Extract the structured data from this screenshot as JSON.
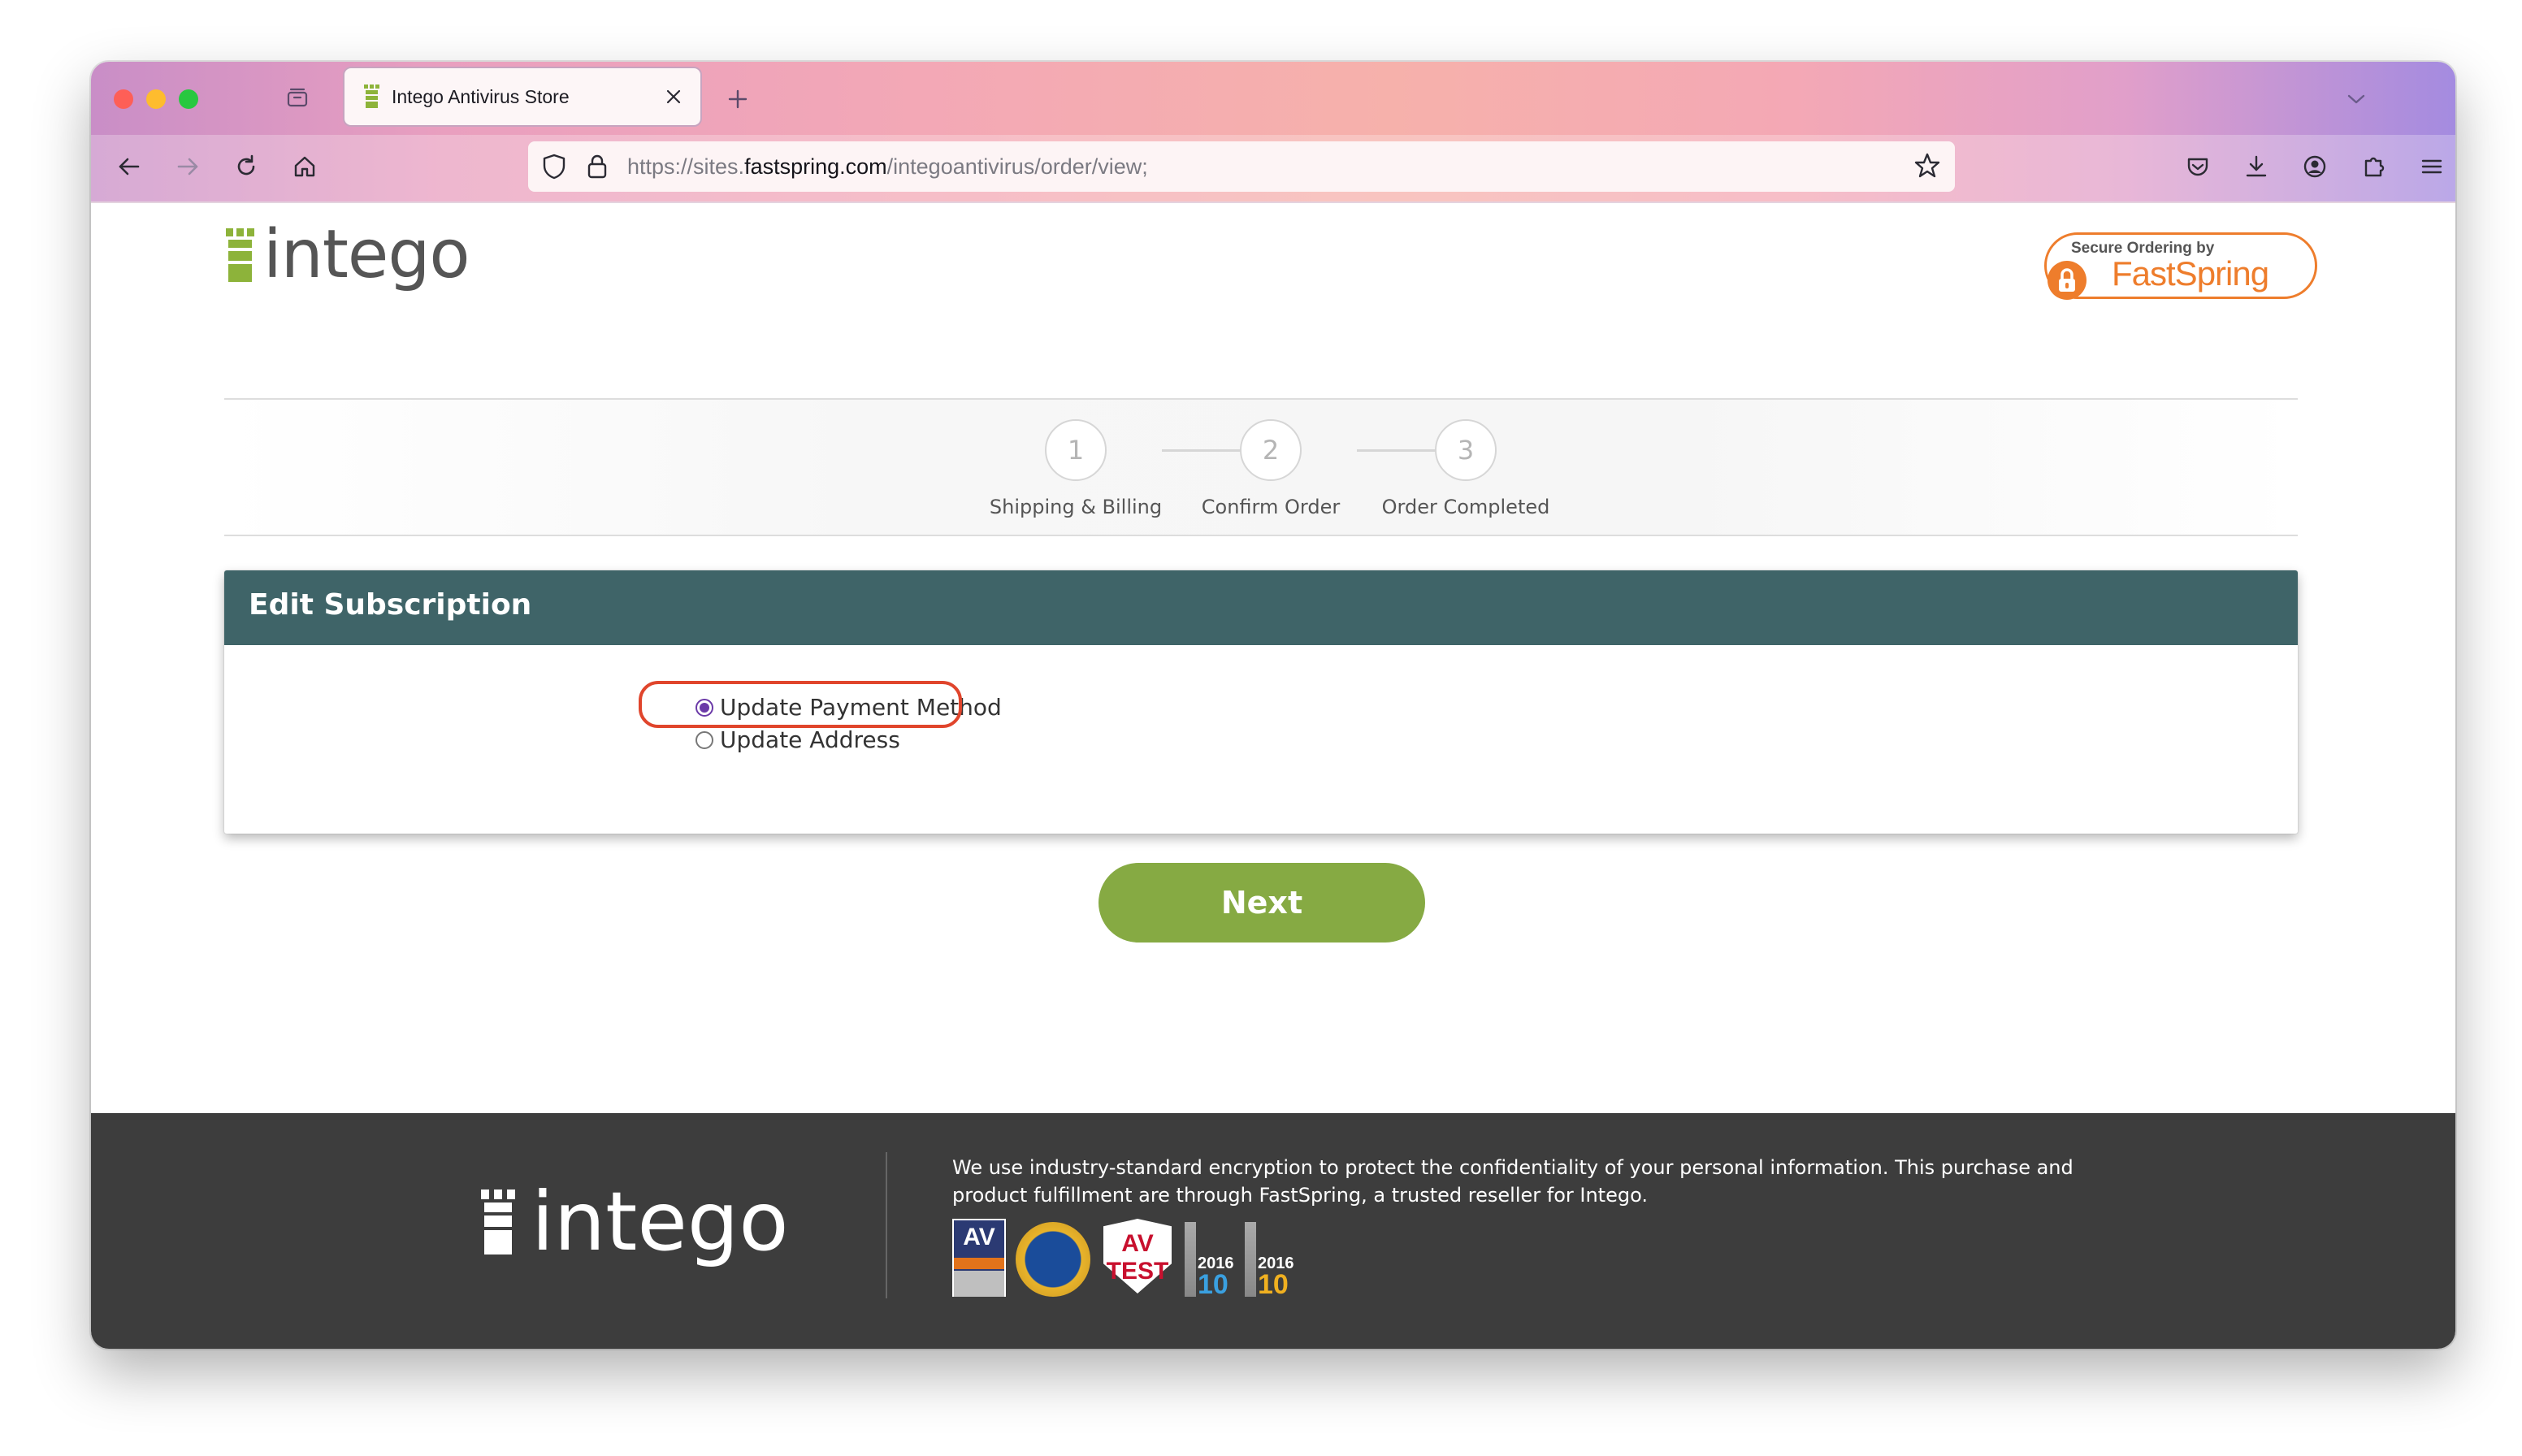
{
  "browser": {
    "tab_title": "Intego Antivirus Store",
    "url_prefix": "https://sites.",
    "url_domain": "fastspring.com",
    "url_path": "/integoantivirus/order/view;"
  },
  "header": {
    "logo_text": "intego",
    "badge_top": "Secure Ordering by",
    "badge_brand": "FastSpring"
  },
  "steps": [
    {
      "number": "1",
      "label": "Shipping & Billing"
    },
    {
      "number": "2",
      "label": "Confirm Order"
    },
    {
      "number": "3",
      "label": "Order Completed"
    }
  ],
  "panel": {
    "title": "Edit Subscription",
    "options": [
      {
        "label": "Update Payment Method",
        "selected": true
      },
      {
        "label": "Update Address",
        "selected": false
      }
    ]
  },
  "next_label": "Next",
  "footer": {
    "logo_text": "intego",
    "text": "We use industry-standard encryption to protect the confidentiality of your personal information. This purchase and product fulfillment are through FastSpring, a trusted reseller for Intego.",
    "badges": {
      "av": "AV",
      "avtest": "AV TEST",
      "year1": "2016",
      "num1": "10",
      "year2": "2016",
      "num2": "10"
    }
  },
  "colors": {
    "panel_header": "#3f6468",
    "next_button": "#86aa43",
    "radio_selected": "#6b3aa8",
    "highlight": "#e0452c",
    "footer_bg": "#3d3d3d",
    "fastspring_orange": "#ee7d2c"
  }
}
